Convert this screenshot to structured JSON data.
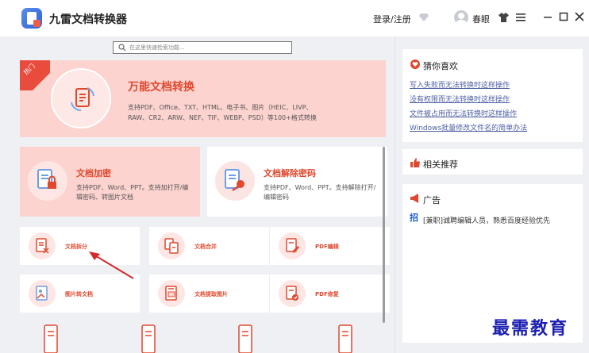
{
  "app": {
    "title": "九雷文档转换器"
  },
  "header": {
    "login": "登录/注册",
    "username": "春眼"
  },
  "search": {
    "placeholder": "在这里快速检索功能..."
  },
  "hero": {
    "badge": "热门",
    "title": "万能文档转换",
    "desc_line1": "支持PDF、Office、TXT、HTML、电子书、图片（HEIC、LIVP、",
    "desc_line2": "RAW、CR2、ARW、NEF、TIF、WEBP、PSD）等100+格式转换"
  },
  "cards": {
    "encrypt": {
      "title": "文档加密",
      "desc": "支持PDF、Word、PPT。支持加打开/编辑密码、转图片文档"
    },
    "decrypt": {
      "title": "文档解除密码",
      "desc": "支持PDF、Word、PPT。支持解除打开/编辑密码"
    },
    "small": [
      {
        "label": "文档拆分"
      },
      {
        "label": "文档合并"
      },
      {
        "label": "PDF编辑"
      },
      {
        "label": "图片转文档"
      },
      {
        "label": "文档提取图片"
      },
      {
        "label": "PDF修复"
      }
    ]
  },
  "sidebar": {
    "guess_title": "猜你喜欢",
    "guess_links": [
      "写入失败而无法转换时这样操作",
      "没有权限而无法转换时这样操作",
      "文件被占用而无法转换时这样操作",
      "Windows批量修改文件名的简单办法"
    ],
    "recommend_title": "相关推荐",
    "ad_title": "广告",
    "ad_badge": "招",
    "ad_text": "[兼职]诚聘编辑人员，熟悉百度经验优先"
  },
  "watermark": "最需教育",
  "colors": {
    "accent": "#e0492f",
    "hero_bg": "#fcd3cf",
    "link": "#4f60a4"
  }
}
